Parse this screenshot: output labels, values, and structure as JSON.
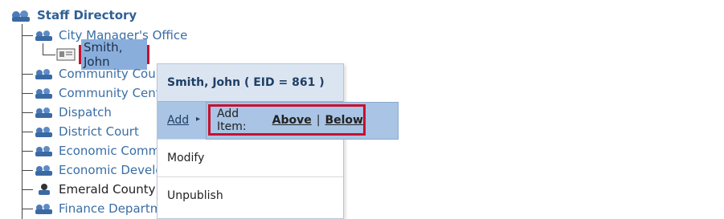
{
  "tree": {
    "root": "Staff Directory",
    "child_open": "City Manager's Office",
    "selected": "Smith, John",
    "items": [
      "Community Cour",
      "Community Cent",
      "Dispatch",
      "District Court",
      "Economic Comm",
      "Economic Develo",
      "Emerald County",
      "Finance Departm"
    ]
  },
  "context_menu": {
    "header": "Smith, John ( EID = 861 )",
    "add": "Add",
    "modify": "Modify",
    "unpublish": "Unpublish",
    "submenu": {
      "prefix": "Add Item:",
      "above": "Above",
      "separator": "|",
      "below": "Below"
    }
  }
}
